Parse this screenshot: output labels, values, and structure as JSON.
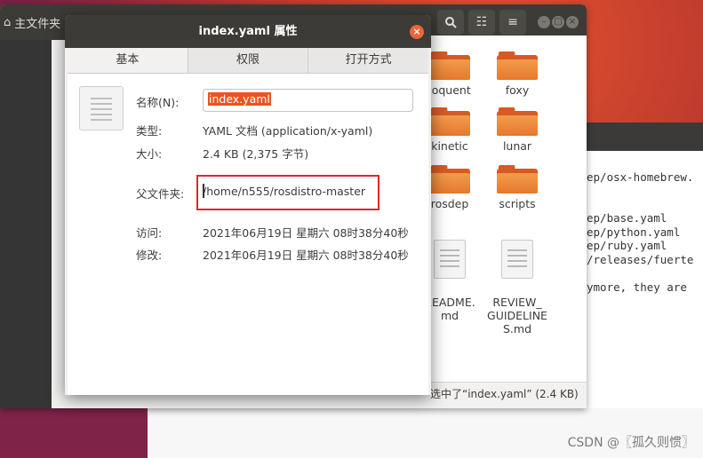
{
  "file_manager": {
    "tab_label": "主文件夹",
    "tab_icon": "home-icon",
    "items": [
      {
        "label": "loquent",
        "type": "folder"
      },
      {
        "label": "foxy",
        "type": "folder"
      },
      {
        "label": "kinetic",
        "type": "folder"
      },
      {
        "label": "lunar",
        "type": "folder"
      },
      {
        "label": "rosdep",
        "type": "folder"
      },
      {
        "label": "scripts",
        "type": "folder"
      },
      {
        "label": "README.\nmd",
        "type": "document"
      },
      {
        "label": "REVIEW_\nGUIDELINE\nS.md",
        "type": "document"
      }
    ],
    "status": "选中了“index.yaml” (2.4 KB)"
  },
  "terminal": {
    "lines": [
      "ep/osx-homebrew.",
      "ep/base.yaml",
      "ep/python.yaml",
      "ep/ruby.yaml",
      "/releases/fuerte",
      "ymore, they are"
    ]
  },
  "dialog": {
    "title": "index.yaml 属性",
    "tabs": [
      "基本",
      "权限",
      "打开方式"
    ],
    "name_label": "名称(N):",
    "name_value": "index.yaml",
    "type_label": "类型:",
    "type_value": "YAML 文档 (application/x-yaml)",
    "size_label": "大小:",
    "size_value": "2.4 KB (2,375 字节)",
    "parent_label": "父文件夹:",
    "parent_value": "/home/n555/rosdistro-master",
    "accessed_label": "访问:",
    "accessed_value": "2021年06月19日 星期六 08时38分40秒",
    "modified_label": "修改:",
    "modified_value": "2021年06月19日 星期六 08时38分40秒"
  },
  "watermark": "CSDN @〖孤久则惯〗",
  "colors": {
    "accent": "#e95420",
    "annotation_box": "#e0262b",
    "titlebar": "#3c3b37"
  }
}
